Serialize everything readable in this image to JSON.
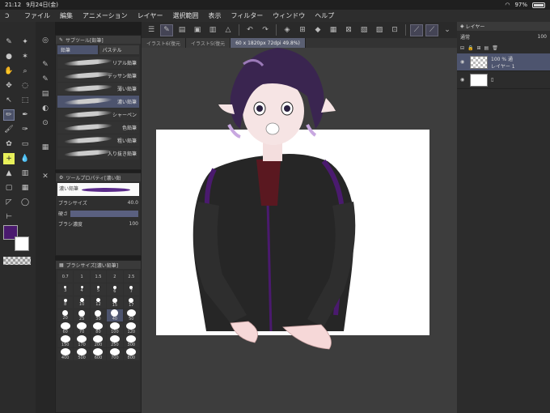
{
  "status": {
    "time": "21:12",
    "date": "9月24日(金)",
    "battery": "97%"
  },
  "menu": [
    "ファイル",
    "編集",
    "アニメーション",
    "レイヤー",
    "選択範囲",
    "表示",
    "フィルター",
    "ウィンドウ",
    "ヘルプ"
  ],
  "doc_tabs": [
    {
      "label": "イラスト6(復元"
    },
    {
      "label": "イラスト5(復元"
    },
    {
      "label": "60 x 1820px 72dpi 49.8%)"
    }
  ],
  "subtool": {
    "title": "サブツール[鉛筆]",
    "tabs": [
      "鉛筆",
      "パステル"
    ],
    "brushes": [
      "リアル鉛筆",
      "デッサン鉛筆",
      "薄い鉛筆",
      "濃い鉛筆",
      "シャーペン",
      "色鉛筆",
      "粗い鉛筆",
      "入り抜き鉛筆"
    ],
    "selected_index": 3
  },
  "tool_property": {
    "title": "ツールプロパティ[濃い鉛",
    "preview_label": "濃い鉛筆",
    "brush_size_label": "ブラシサイズ",
    "brush_size": "40.0",
    "hardness_label": "硬さ",
    "density_label": "ブラシ濃度",
    "density": "100"
  },
  "brush_sizes": {
    "title": "ブラシサイズ[濃い鉛筆]",
    "values": [
      "0.7",
      "1",
      "1.5",
      "2",
      "2.5",
      "3",
      "4",
      "5",
      "6",
      "7",
      "8",
      "10",
      "12",
      "15",
      "17",
      "20",
      "25",
      "30",
      "40",
      "50",
      "60",
      "70",
      "80",
      "100",
      "120",
      "150",
      "170",
      "200",
      "250",
      "300",
      "400",
      "500",
      "600",
      "700",
      "800"
    ],
    "selected": "40"
  },
  "layers": {
    "title": "レイヤー",
    "blend_mode": "通常",
    "opacity": "100",
    "items": [
      {
        "name": "100 % 通\nレイヤー 1",
        "percent": "100 %",
        "mode": "通",
        "label": "レイヤー 1",
        "selected": true
      },
      {
        "name": "",
        "percent": "",
        "mode": "",
        "label": "",
        "selected": false
      }
    ]
  },
  "colors": {
    "main": "#4a1a6e",
    "sub": "#ffffff",
    "accent": "#4d546e"
  }
}
